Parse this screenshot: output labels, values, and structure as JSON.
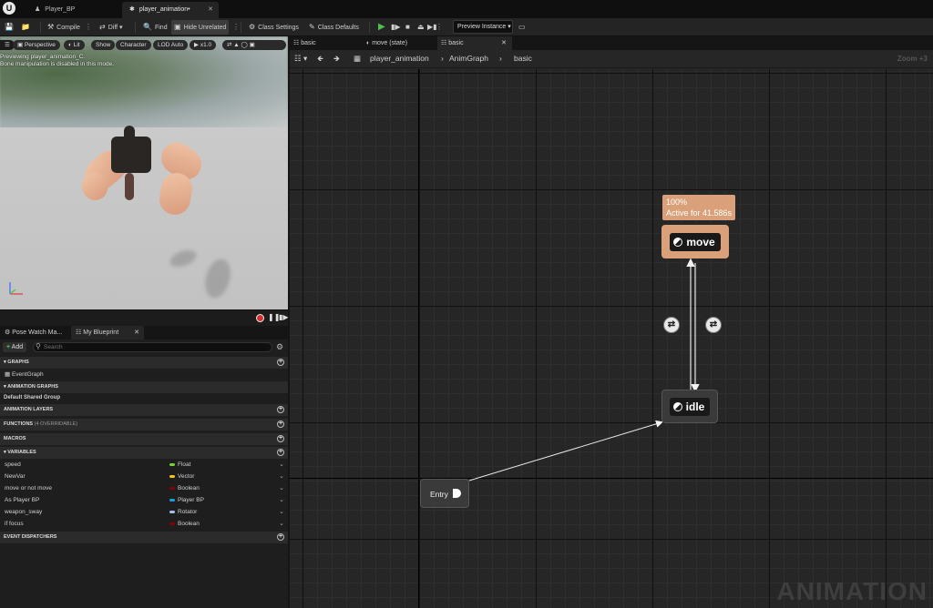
{
  "doc_tabs": [
    {
      "label": "Player_BP",
      "icon": "person-icon"
    },
    {
      "label": "player_animation•",
      "icon": "animation-icon"
    }
  ],
  "toolbar": {
    "compile": "Compile",
    "diff": "Diff",
    "find": "Find",
    "hide_unrelated": "Hide Unrelated",
    "class_settings": "Class Settings",
    "class_defaults": "Class Defaults",
    "preview_instance": "Preview Instance"
  },
  "viewport": {
    "buttons": [
      "Perspective",
      "Lit",
      "Show",
      "Character",
      "LOD Auto",
      "x1.0"
    ],
    "messages": [
      "Previewing player_animation_C.",
      "Bone manipulation is disabled in this mode."
    ]
  },
  "blueprint_panel": {
    "tabs": [
      "Pose Watch Ma...",
      "My Blueprint"
    ],
    "add_label": "Add",
    "search_placeholder": "Search",
    "sections": {
      "graphs": "GRAPHS",
      "event_graph": "EventGraph",
      "animation_graphs": "ANIMATION GRAPHS",
      "default_shared_group": "Default Shared Group",
      "animation_layers": "ANIMATION LAYERS",
      "functions": "FUNCTIONS",
      "functions_overridable": "(4 OVERRIDABLE)",
      "macros": "MACROS",
      "variables": "VARIABLES",
      "event_dispatchers": "EVENT DISPATCHERS"
    },
    "variables": [
      {
        "name": "speed",
        "type": "Float",
        "color": "#7bd13a"
      },
      {
        "name": "NewVar",
        "type": "Vector",
        "color": "#f5c518"
      },
      {
        "name": "move or not move",
        "type": "Boolean",
        "color": "#8a0000"
      },
      {
        "name": "As Player BP",
        "type": "Player BP",
        "color": "#1f9be0"
      },
      {
        "name": "weapon_sway",
        "type": "Rotator",
        "color": "#a8b8f8"
      },
      {
        "name": "if focus",
        "type": "Boolean",
        "color": "#8a0000"
      }
    ]
  },
  "graph": {
    "tabs": [
      "basic",
      "move (state)",
      "basic"
    ],
    "breadcrumb": [
      "player_animation",
      "AnimGraph",
      "basic"
    ],
    "zoom": "Zoom +3",
    "move_tooltip": [
      "100%",
      "Active for 41.586s"
    ],
    "states": {
      "move": "move",
      "idle": "idle"
    },
    "entry": "Entry",
    "watermark": "ANIMATION",
    "active_color": "#d9a07a"
  }
}
